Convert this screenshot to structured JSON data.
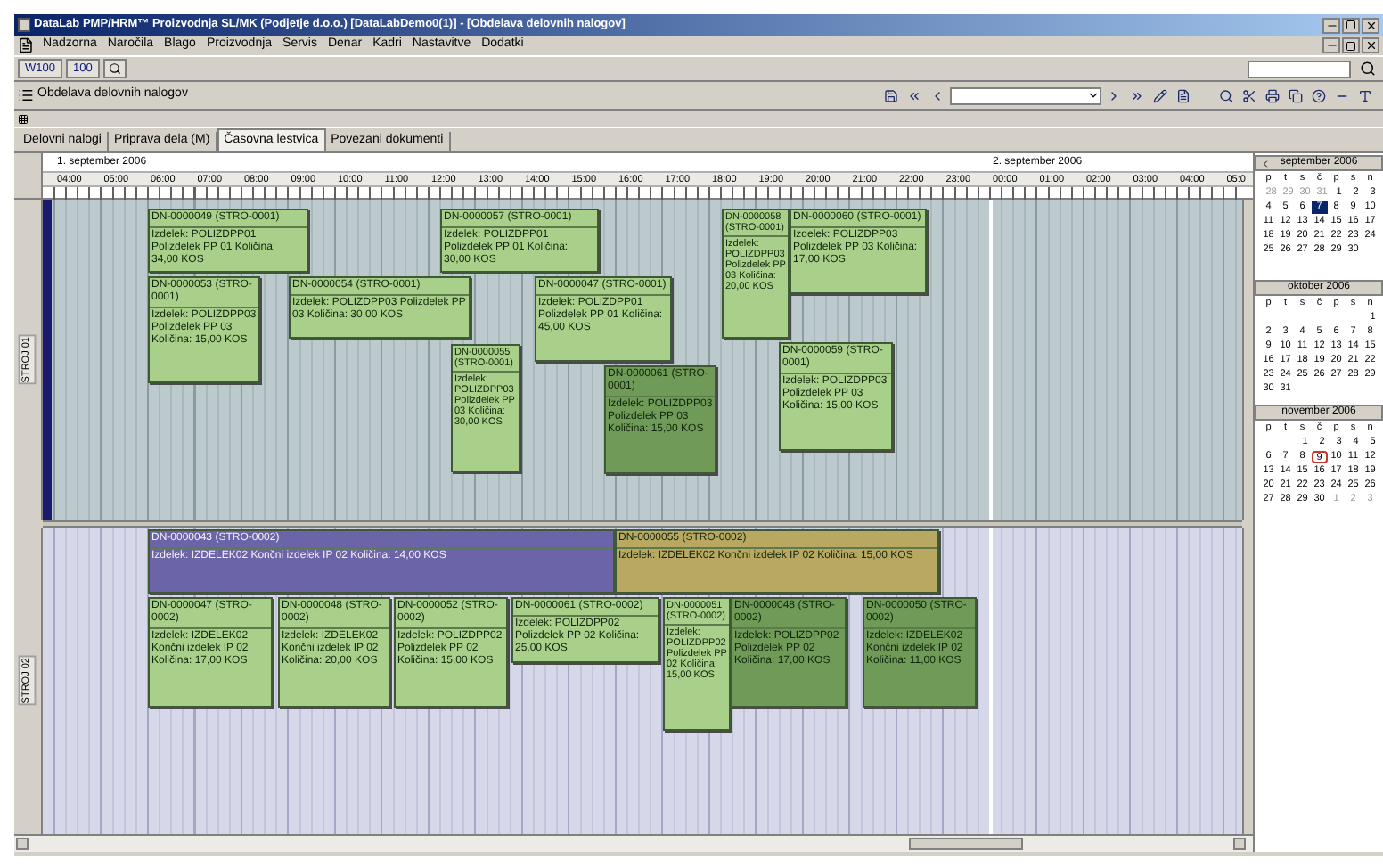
{
  "window": {
    "title": "DataLab PMP/HRM™ Proizvodnja SL/MK (Podjetje d.o.o.) [DataLabDemo0(1)] - [Obdelava delovnih nalogov]"
  },
  "menu": [
    "Nadzorna",
    "Naročila",
    "Blago",
    "Proizvodnja",
    "Servis",
    "Denar",
    "Kadri",
    "Nastavitve",
    "Dodatki"
  ],
  "toolbar": {
    "buttons": [
      "W100",
      "100"
    ]
  },
  "form": {
    "title": "Obdelava delovnih nalogov"
  },
  "tabs": [
    {
      "label": "Delovni nalogi",
      "selected": false
    },
    {
      "label": "Priprava dela (M)",
      "selected": false
    },
    {
      "label": "Časovna lestvica",
      "selected": true
    },
    {
      "label": "Povezani dokumenti",
      "selected": false
    }
  ],
  "timeline": {
    "days": [
      "1. september 2006",
      "2. september 2006"
    ],
    "hours": [
      "04:00",
      "05:00",
      "06:00",
      "07:00",
      "08:00",
      "09:00",
      "10:00",
      "11:00",
      "12:00",
      "13:00",
      "14:00",
      "15:00",
      "16:00",
      "17:00",
      "18:00",
      "19:00",
      "20:00",
      "21:00",
      "22:00",
      "23:00",
      "00:00",
      "01:00",
      "02:00",
      "03:00",
      "04:00",
      "05:0"
    ],
    "lanes": [
      {
        "label": "STROJ 01",
        "selected": true,
        "cards": [
          {
            "title": "DN-0000049 (STRO-0001)",
            "text": "Izdelek: POLIZDPP01 Polizdelek PP 01 Količina: 34,00 KOS",
            "color": "#a8d08a"
          },
          {
            "title": "DN-0000057 (STRO-0001)",
            "text": "Izdelek: POLIZDPP01 Polizdelek PP 01 Količina: 30,00 KOS",
            "color": "#a8d08a"
          },
          {
            "title": "DN-0000058 (STRO-0001)",
            "text": "Izdelek: POLIZDPP03 Polizdelek PP 03 Količina: 20,00 KOS",
            "color": "#a8d08a"
          },
          {
            "title": "DN-0000060 (STRO-0001)",
            "text": "Izdelek: POLIZDPP03 Polizdelek PP 03 Količina: 17,00 KOS",
            "color": "#a8d08a"
          },
          {
            "title": "DN-0000053 (STRO-0001)",
            "text": "Izdelek: POLIZDPP03 Polizdelek PP 03 Količina: 15,00 KOS",
            "color": "#a8d08a"
          },
          {
            "title": "DN-0000054 (STRO-0001)",
            "text": "Izdelek: POLIZDPP03 Polizdelek PP 03 Količina: 30,00 KOS",
            "color": "#a8d08a"
          },
          {
            "title": "DN-0000047 (STRO-0001)",
            "text": "Izdelek: POLIZDPP01 Polizdelek PP 01 Količina: 45,00 KOS",
            "color": "#a8d08a"
          },
          {
            "title": "DN-0000055 (STRO-0001)",
            "text": "Izdelek: POLIZDPP03 Polizdelek PP 03 Količina: 30,00 KOS",
            "color": "#a8d08a"
          },
          {
            "title": "DN-0000061 (STRO-0001)",
            "text": "Izdelek: POLIZDPP03 Polizdelek PP 03 Količina: 15,00 KOS",
            "color": "#6f9a58"
          },
          {
            "title": "DN-0000059 (STRO-0001)",
            "text": "Izdelek: POLIZDPP03 Polizdelek PP 03 Količina: 15,00 KOS",
            "color": "#a8d08a"
          }
        ]
      },
      {
        "label": "STROJ 02",
        "selected": false,
        "cards": [
          {
            "title": "DN-0000043 (STRO-0002)",
            "text": "Izdelek: IZDELEK02 Končni izdelek IP 02 Količina: 14,00 KOS",
            "color": "#6c64a8"
          },
          {
            "title": "DN-0000055 (STRO-0002)",
            "text": "Izdelek: IZDELEK02 Končni izdelek IP 02 Količina: 15,00 KOS",
            "color": "#b8a862"
          },
          {
            "title": "DN-0000047 (STRO-0002)",
            "text": "Izdelek: IZDELEK02 Končni izdelek IP 02 Količina: 17,00 KOS",
            "color": "#a8d08a"
          },
          {
            "title": "DN-0000048 (STRO-0002)",
            "text": "Izdelek: IZDELEK02 Končni izdelek IP 02 Količina: 20,00 KOS",
            "color": "#a8d08a"
          },
          {
            "title": "DN-0000052 (STRO-0002)",
            "text": "Izdelek: POLIZDPP02 Polizdelek PP 02 Količina: 15,00 KOS",
            "color": "#a8d08a"
          },
          {
            "title": "DN-0000061 (STRO-0002)",
            "text": "Izdelek: POLIZDPP02 Polizdelek PP 02 Količina: 25,00 KOS",
            "color": "#a8d08a"
          },
          {
            "title": "DN-0000051 (STRO-0002)",
            "text": "Izdelek: POLIZDPP02 Polizdelek PP 02 Količina: 15,00 KOS",
            "color": "#a8d08a"
          },
          {
            "title": "DN-0000048 (STRO-0002)",
            "text": "Izdelek: POLIZDPP02 Polizdelek PP 02 Količina: 17,00 KOS",
            "color": "#6f9a58"
          },
          {
            "title": "DN-0000050 (STRO-0002)",
            "text": "Izdelek: IZDELEK02 Končni izdelek IP 02 Količina: 11,00 KOS",
            "color": "#6f9a58"
          }
        ]
      }
    ]
  },
  "calendar": {
    "months": [
      {
        "title": "september 2006",
        "weekdays": [
          "p",
          "t",
          "s",
          "č",
          "p",
          "s",
          "n"
        ],
        "weeks": [
          [
            {
              "day": "28",
              "selected": false,
              "muted": true
            },
            {
              "day": "29",
              "selected": false,
              "muted": true
            },
            {
              "day": "30",
              "selected": false,
              "muted": true
            },
            {
              "day": "31",
              "selected": false,
              "muted": true
            },
            {
              "day": "1",
              "selected": false
            },
            {
              "day": "2",
              "selected": false
            },
            {
              "day": "3",
              "selected": false
            }
          ],
          [
            {
              "day": "4",
              "selected": false
            },
            {
              "day": "5",
              "selected": false
            },
            {
              "day": "6",
              "selected": false
            },
            {
              "day": "7",
              "selected": true
            },
            {
              "day": "8",
              "selected": false
            },
            {
              "day": "9",
              "selected": false
            },
            {
              "day": "10",
              "selected": false
            }
          ],
          [
            {
              "day": "11",
              "selected": false
            },
            {
              "day": "12",
              "selected": false
            },
            {
              "day": "13",
              "selected": false
            },
            {
              "day": "14",
              "selected": false
            },
            {
              "day": "15",
              "selected": false
            },
            {
              "day": "16",
              "selected": false
            },
            {
              "day": "17",
              "selected": false
            }
          ],
          [
            {
              "day": "18",
              "selected": false
            },
            {
              "day": "19",
              "selected": false
            },
            {
              "day": "20",
              "selected": false
            },
            {
              "day": "21",
              "selected": false
            },
            {
              "day": "22",
              "selected": false
            },
            {
              "day": "23",
              "selected": false
            },
            {
              "day": "24",
              "selected": false
            }
          ],
          [
            {
              "day": "25",
              "selected": false
            },
            {
              "day": "26",
              "selected": false
            },
            {
              "day": "27",
              "selected": false
            },
            {
              "day": "28",
              "selected": false
            },
            {
              "day": "29",
              "selected": false
            },
            {
              "day": "30",
              "selected": false
            }
          ]
        ]
      },
      {
        "title": "oktober 2006",
        "weekdays": [
          "p",
          "t",
          "s",
          "č",
          "p",
          "s",
          "n"
        ],
        "weeks": [
          [
            {
              "day": "1",
              "selected": false
            }
          ],
          [
            {
              "day": "2",
              "selected": false
            },
            {
              "day": "3",
              "selected": false
            },
            {
              "day": "4",
              "selected": false
            },
            {
              "day": "5",
              "selected": false
            },
            {
              "day": "6",
              "selected": false
            },
            {
              "day": "7",
              "selected": false
            },
            {
              "day": "8",
              "selected": false
            }
          ],
          [
            {
              "day": "9",
              "selected": false
            },
            {
              "day": "10",
              "selected": false
            },
            {
              "day": "11",
              "selected": false
            },
            {
              "day": "12",
              "selected": false
            },
            {
              "day": "13",
              "selected": false
            },
            {
              "day": "14",
              "selected": false
            },
            {
              "day": "15",
              "selected": false
            }
          ],
          [
            {
              "day": "16",
              "selected": false
            },
            {
              "day": "17",
              "selected": false
            },
            {
              "day": "18",
              "selected": false
            },
            {
              "day": "19",
              "selected": false
            },
            {
              "day": "20",
              "selected": false
            },
            {
              "day": "21",
              "selected": false
            },
            {
              "day": "22",
              "selected": false
            }
          ],
          [
            {
              "day": "23",
              "selected": false
            },
            {
              "day": "24",
              "selected": false
            },
            {
              "day": "25",
              "selected": false
            },
            {
              "day": "26",
              "selected": false
            },
            {
              "day": "27",
              "selected": false
            },
            {
              "day": "28",
              "selected": false
            },
            {
              "day": "29",
              "selected": false
            }
          ],
          [
            {
              "day": "30",
              "selected": false
            },
            {
              "day": "31",
              "selected": false
            }
          ]
        ]
      },
      {
        "title": "november 2006",
        "weekdays": [
          "p",
          "t",
          "s",
          "č",
          "p",
          "s",
          "n"
        ],
        "weeks": [
          [
            {
              "day": "1",
              "selected": false
            },
            {
              "day": "2",
              "selected": false
            },
            {
              "day": "3",
              "selected": false
            },
            {
              "day": "4",
              "selected": false
            },
            {
              "day": "5",
              "selected": false
            }
          ],
          [
            {
              "day": "6",
              "selected": false
            },
            {
              "day": "7",
              "selected": false
            },
            {
              "day": "8",
              "selected": false
            },
            {
              "day": "9",
              "selected": false,
              "today": true
            },
            {
              "day": "10",
              "selected": false
            },
            {
              "day": "11",
              "selected": false
            },
            {
              "day": "12",
              "selected": false
            }
          ],
          [
            {
              "day": "13",
              "selected": false
            },
            {
              "day": "14",
              "selected": false
            },
            {
              "day": "15",
              "selected": false
            },
            {
              "day": "16",
              "selected": false
            },
            {
              "day": "17",
              "selected": false
            },
            {
              "day": "18",
              "selected": false
            },
            {
              "day": "19",
              "selected": false
            }
          ],
          [
            {
              "day": "20",
              "selected": false
            },
            {
              "day": "21",
              "selected": false
            },
            {
              "day": "22",
              "selected": false
            },
            {
              "day": "23",
              "selected": false
            },
            {
              "day": "24",
              "selected": false
            },
            {
              "day": "25",
              "selected": false
            },
            {
              "day": "26",
              "selected": false
            }
          ],
          [
            {
              "day": "27",
              "selected": false
            },
            {
              "day": "28",
              "selected": false
            },
            {
              "day": "29",
              "selected": false
            },
            {
              "day": "30",
              "selected": false
            },
            {
              "day": "1",
              "selected": false,
              "muted": true
            },
            {
              "day": "2",
              "selected": false,
              "muted": true
            },
            {
              "day": "3",
              "selected": false,
              "muted": true
            }
          ]
        ]
      }
    ]
  }
}
